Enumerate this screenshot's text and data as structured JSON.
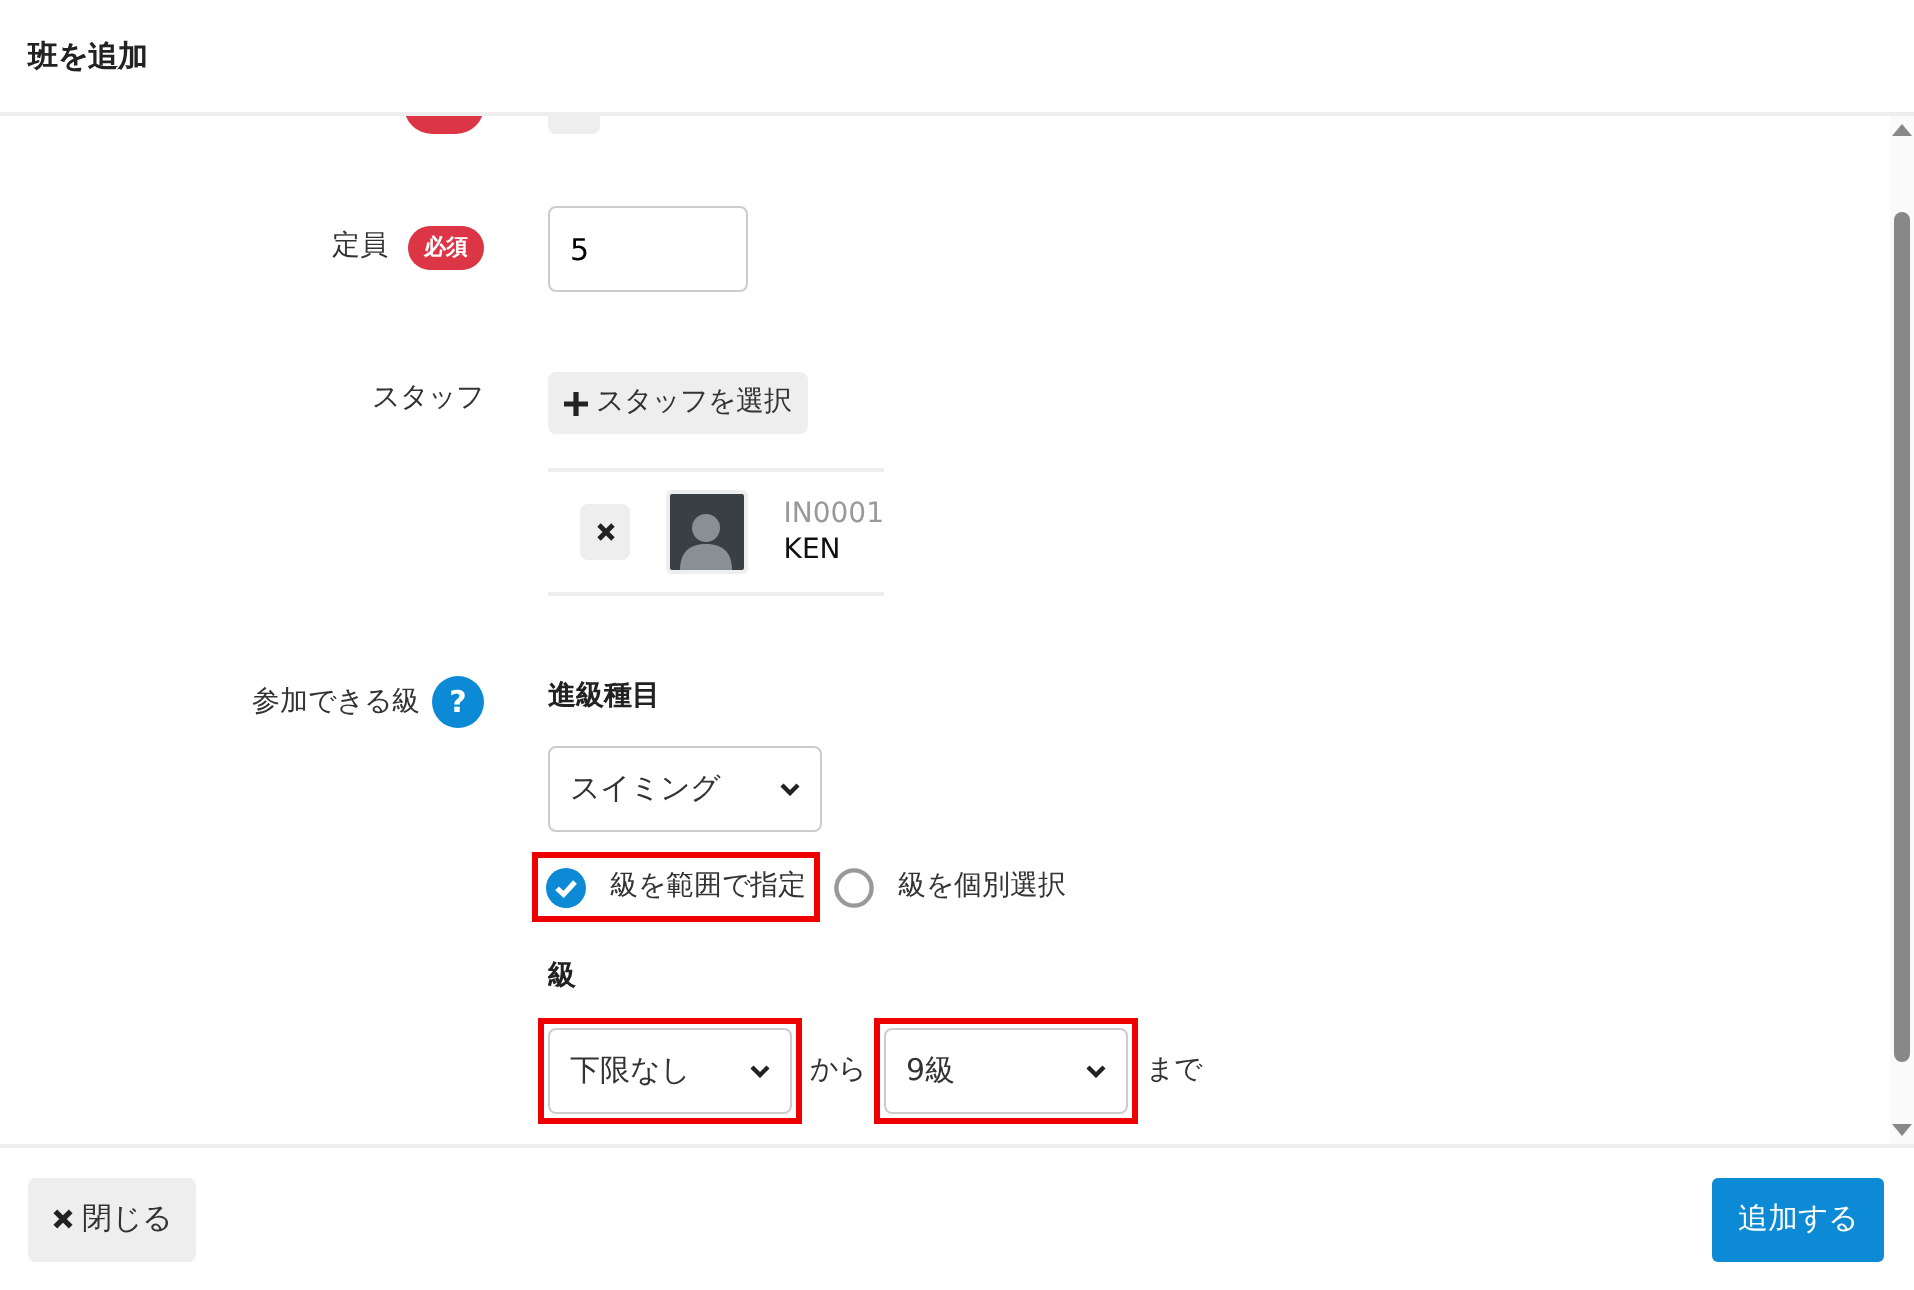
{
  "modal": {
    "title": "班を追加"
  },
  "partial_row": {
    "required": true
  },
  "capacity": {
    "label": "定員",
    "required": true,
    "badge": "必須",
    "value": "5"
  },
  "staff": {
    "label": "スタッフ",
    "add_button": "スタッフを選択",
    "members": [
      {
        "code": "IN0001",
        "name": "KEN"
      }
    ]
  },
  "grades": {
    "label": "参加できる級",
    "help": "?",
    "category_label": "進級種目",
    "category": "スイミング",
    "modes": [
      {
        "label": "級を範囲で指定",
        "selected": true,
        "highlighted": true
      },
      {
        "label": "級を個別選択",
        "selected": false,
        "highlighted": false
      }
    ],
    "grade_label": "級",
    "from": {
      "value": "下限なし",
      "highlighted": true
    },
    "from_text": "から",
    "to": {
      "value": "9級",
      "highlighted": true
    },
    "to_text": "まで"
  },
  "footer": {
    "close": "閉じる",
    "submit": "追加する"
  }
}
